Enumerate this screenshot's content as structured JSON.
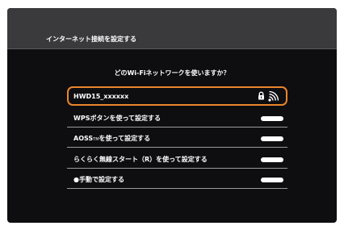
{
  "header": {
    "title": "インターネット接続を設定する"
  },
  "question": "どのWi-Fiネットワークを使いますか？",
  "networks": [
    {
      "label": "HWD15_xxxxxx",
      "icons": [
        "lock-icon",
        "wifi-signal-icon"
      ]
    }
  ],
  "options": [
    {
      "label": "WPSボタンを使って設定する"
    },
    {
      "label_prefix": "AOSS",
      "label_mark": "TM",
      "label_suffix": "を使って設定する"
    },
    {
      "label": "らくらく無線スタート（R）を使って設定する"
    },
    {
      "label": "●手動で設定する"
    }
  ],
  "colors": {
    "selection_border": "#e9862c",
    "background": "#0e0d10",
    "header": "#3a3a3d"
  }
}
